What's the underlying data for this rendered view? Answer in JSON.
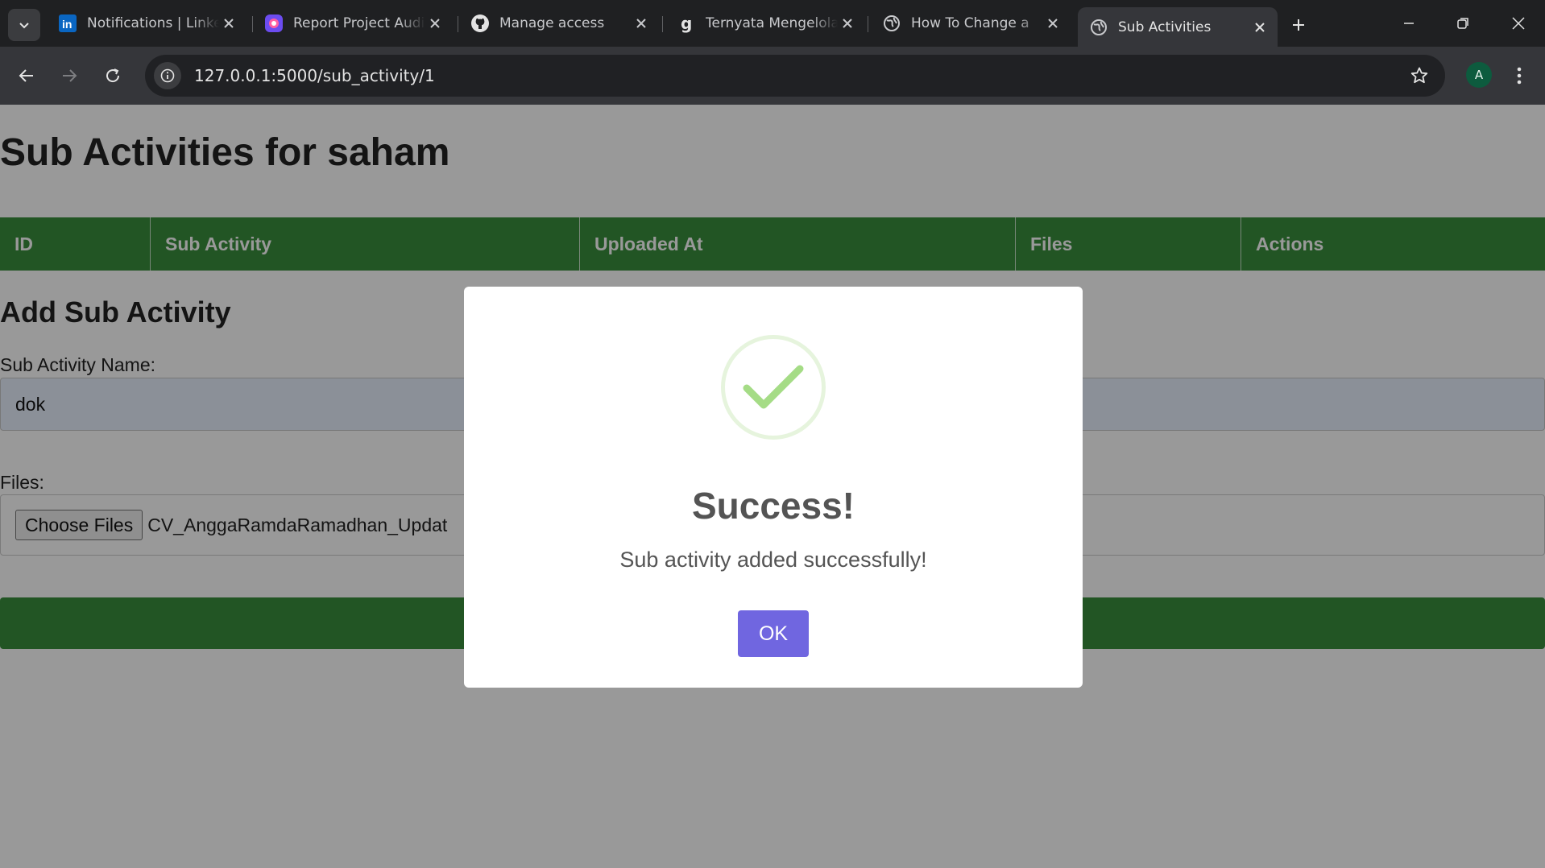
{
  "browser": {
    "tabs": [
      {
        "title": "Notifications | LinkedIn",
        "icon": "linkedin-icon"
      },
      {
        "title": "Report Project Audit",
        "icon": "app-icon"
      },
      {
        "title": "Manage access",
        "icon": "github-icon"
      },
      {
        "title": "Ternyata Mengelola",
        "icon": "g-icon"
      },
      {
        "title": "How To Change a",
        "icon": "globe-icon"
      },
      {
        "title": "Sub Activities",
        "icon": "globe-icon",
        "active": true
      }
    ],
    "url": "127.0.0.1:5000/sub_activity/1",
    "profile_initial": "A"
  },
  "page": {
    "title": "Sub Activities for saham",
    "table_headers": [
      "ID",
      "Sub Activity",
      "Uploaded At",
      "Files",
      "Actions"
    ],
    "form_title": "Add Sub Activity",
    "name_label": "Sub Activity Name:",
    "name_value": "dok",
    "files_label": "Files:",
    "choose_files_label": "Choose Files",
    "chosen_file": "CV_AnggaRamdaRamadhan_Updat"
  },
  "dialog": {
    "title": "Success!",
    "message": "Sub activity added successfully!",
    "ok_label": "OK",
    "icon": "success-check-icon"
  },
  "colors": {
    "tab_strip": "#1f2022",
    "toolbar": "#35363a",
    "table_header": "#3a8e3c",
    "ok_button": "#7066e0",
    "check": "#a5dc86"
  }
}
